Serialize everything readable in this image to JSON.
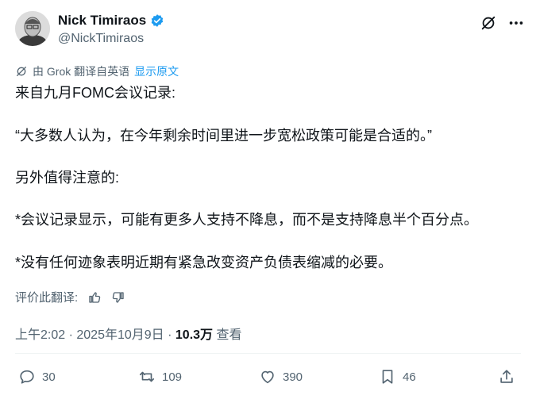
{
  "author": {
    "name": "Nick Timiraos",
    "handle": "@NickTimiraos",
    "verified": true
  },
  "translation": {
    "notice": "由 Grok 翻译自英语",
    "show_original": "显示原文",
    "rate_label": "评价此翻译:"
  },
  "post": {
    "line1": "来自九月FOMC会议记录:",
    "line2": "“大多数人认为，在今年剩余时间里进一步宽松政策可能是合适的。”",
    "line3": "另外值得注意的:",
    "line4": "*会议记录显示，可能有更多人支持不降息，而不是支持降息半个百分点。",
    "line5": "*没有任何迹象表明近期有紧急改变资产负债表缩减的必要。"
  },
  "meta": {
    "time": "上午2:02",
    "sep1": " · ",
    "date": "2025年10月9日",
    "sep2": " · ",
    "views": "10.3万",
    "views_label": " 查看"
  },
  "actions": {
    "replies": "30",
    "reposts": "109",
    "likes": "390",
    "bookmarks": "46"
  },
  "colors": {
    "text": "#0f1419",
    "secondary": "#536471",
    "accent": "#1d9bf0"
  }
}
